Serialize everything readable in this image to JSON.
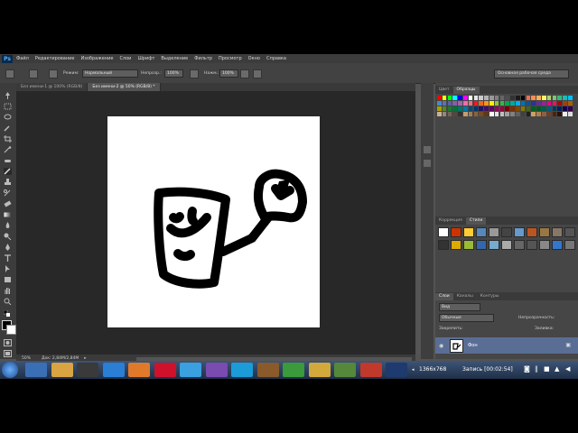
{
  "app": {
    "logo": "Ps"
  },
  "menu": [
    "Файл",
    "Редактирование",
    "Изображение",
    "Слои",
    "Шрифт",
    "Выделение",
    "Фильтр",
    "Просмотр",
    "Окно",
    "Справка"
  ],
  "options": {
    "mode_label": "Режим:",
    "mode_value": "Нормальный",
    "opacity_label": "Непрозр.:",
    "opacity_value": "100%",
    "flow_label": "Нажм.:",
    "flow_value": "100%",
    "workspace": "Основная рабочая среда"
  },
  "doc_tabs": [
    {
      "label": "Без имени-1 @ 100% (RGB/8)",
      "active": false
    },
    {
      "label": "Без имени-2 @ 50% (RGB/8) *",
      "active": true
    }
  ],
  "status": {
    "zoom": "50%",
    "doc_info": "Док: 2,84М/2,84М"
  },
  "panels": {
    "color_tabs": [
      "Цвет",
      "Образцы"
    ],
    "style_tabs": [
      "Коррекция",
      "Стили"
    ],
    "layer_tabs": [
      "Слои",
      "Каналы",
      "Контуры"
    ],
    "kind_label": "Вид",
    "blend_mode": "Обычные",
    "opacity_label": "Непрозрачность:",
    "lock_label": "Закрепить:",
    "fill_label": "Заливка:",
    "layer_name": "Фон"
  },
  "taskbar": {
    "resolution": "1366x768",
    "recording": "Запись [00:02:54]"
  },
  "colors": {
    "swatch_row1": [
      "#ff0000",
      "#ffff00",
      "#00ff00",
      "#00ffff",
      "#0000ff",
      "#ff00ff",
      "#ffffff",
      "#e6e6e6",
      "#cccccc",
      "#b3b3b3",
      "#999999",
      "#808080",
      "#666666",
      "#4d4d4d",
      "#333333",
      "#1a1a1a",
      "#000000",
      "#f26c4f",
      "#f68e55",
      "#fbaf5c",
      "#fff467",
      "#acd372",
      "#7cc576",
      "#3bb878",
      "#1abbb4",
      "#00bff3"
    ],
    "swatch_row2": [
      "#438ccb",
      "#5574b9",
      "#605ca8",
      "#855fa8",
      "#a763a9",
      "#ef6ea8",
      "#f16d7e",
      "#ed1c24",
      "#f26522",
      "#f7941d",
      "#fff200",
      "#8dc63f",
      "#39b54a",
      "#00a651",
      "#00a99d",
      "#00aeef",
      "#0072bc",
      "#0054a6",
      "#2e3192",
      "#662d91",
      "#92278f",
      "#ec008c",
      "#ed145b",
      "#9e0b0f",
      "#a0410d",
      "#a3620a"
    ],
    "swatch_row3": [
      "#aba000",
      "#598527",
      "#1a7b30",
      "#007236",
      "#00746b",
      "#0076a3",
      "#004a80",
      "#003471",
      "#1b1464",
      "#440e62",
      "#630460",
      "#9e005d",
      "#9e0039",
      "#790000",
      "#7b2e00",
      "#7d4900",
      "#827b00",
      "#406618",
      "#005e20",
      "#005826",
      "#005952",
      "#005b7f",
      "#003663",
      "#002157",
      "#0d004c",
      "#32004b"
    ],
    "swatch_row4": [
      "#c7b299",
      "#998675",
      "#736357",
      "#534741",
      "#37302d",
      "#c69c6d",
      "#a67c52",
      "#8c6239",
      "#754c24",
      "#603913",
      "#ffffff",
      "#e0e0e0",
      "#c0c0c0",
      "#a0a0a0",
      "#808080",
      "#606060",
      "#404040",
      "#202020",
      "#d0a060",
      "#b08050",
      "#906040",
      "#704020",
      "#502010",
      "#301000",
      "#eeeeee",
      "#dddddd"
    ],
    "styles": [
      "#ffffff",
      "#cc3300",
      "#ffcc33",
      "#5588bb",
      "#999999",
      "#444444",
      "#6699cc",
      "#bb5522",
      "#997744",
      "#887766",
      "#555555",
      "#333333",
      "#ddaa00",
      "#99bb33",
      "#3366aa",
      "#77aacc",
      "#aaaaaa",
      "#666666",
      "#555555",
      "#888888",
      "#3377cc",
      "#777777"
    ],
    "taskbar_apps": [
      "#3b6fb5",
      "#d9a441",
      "#3a3a3a",
      "#2a7fd4",
      "#e07a2a",
      "#d0112b",
      "#3aa0e0",
      "#7a4bb0",
      "#1b9bd7",
      "#8a5a2a",
      "#3b9a3b",
      "#d4a93b",
      "#55883b",
      "#c0392b",
      "#1e3a6e"
    ]
  }
}
